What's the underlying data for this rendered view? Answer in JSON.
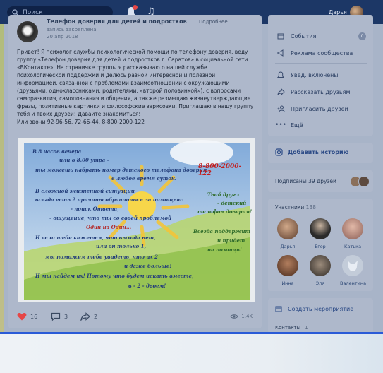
{
  "topbar": {
    "search_placeholder": "Поиск",
    "user_name": "Дарья"
  },
  "post": {
    "title": "Телефон доверия для детей и подростков",
    "subtitle": "запись закреплена",
    "date": "20 апр 2018",
    "more_label": "Подробнее",
    "text": "Привет! Я психолог службы психологической помощи по телефону доверия, веду группу «Телефон доверия для детей и подростков г. Саратов» в социальной сети «ВКонтакте». На страничке группы я рассказываю о нашей службе психологической поддержки и делюсь разной интересной и полезной информацией, связанной с проблемами взаимоотношений с окружающими (друзьями, одноклассниками, родителями, «второй половинкой»), с вопросами саморазвития, самопознания и общения, а также размещаю жизнеутверждающие фразы, позитивные картинки и философские зарисовки. Приглашаю в нашу группу тебя и твоих друзей! Давайте знакомиться!\nИли звони 92-96-56, 72-66-44, 8-800-2000-122",
    "image": {
      "line1": "В 8 часов вечера",
      "line2": "или в 8.00 утра –",
      "line3": "ты можешь набрать номер детского телефона доверия",
      "line4": "в любое время суток.",
      "phone": "8-800-2000-122",
      "line5": "В сложной жизненной ситуации",
      "line6": "всегда есть 2 причины обратиться за помощью:",
      "line7": "- поиск Ответа,",
      "line8": "- ощущение, что ты со своей проблемой",
      "line9": "Один на Один...",
      "line10": "И если тебе кажется, что выхода нет,",
      "line11": "или он только 1,",
      "line12": "мы поможем тебе увидеть, что их 2",
      "line13": "и даже больше!",
      "line14": "И мы найдем их! Потому что будем искать вместе,",
      "line15": "в - 2 - двоем!",
      "right1": "Твой друг -",
      "right2": "- детский",
      "right3": "телефон доверия!",
      "right4": "Всегда поддержит",
      "right5": "и придет",
      "right6": "на помощь!"
    },
    "likes": "16",
    "comments": "3",
    "shares": "2",
    "views": "1.4K"
  },
  "menu": {
    "events": "События",
    "events_count": "0",
    "ads": "Реклама сообщества",
    "notify": "Увед. включены",
    "tell_friends": "Рассказать друзьям",
    "invite": "Пригласить друзей",
    "more": "Ещё"
  },
  "story": {
    "label": "Добавить историю"
  },
  "subscribed": {
    "label": "Подписаны 39 друзей"
  },
  "members": {
    "label": "Участники",
    "count": "138",
    "items": [
      {
        "name": "Дарья"
      },
      {
        "name": "Егор"
      },
      {
        "name": "Катька"
      },
      {
        "name": "Инна"
      },
      {
        "name": "Эля"
      },
      {
        "name": "Валентина"
      }
    ]
  },
  "event": {
    "label": "Создать мероприятие"
  },
  "contacts": {
    "label": "Контакты",
    "count": "1"
  },
  "colors": {
    "accent": "#2a5bd7",
    "topbar": "#1c3766",
    "like": "#e64646"
  }
}
